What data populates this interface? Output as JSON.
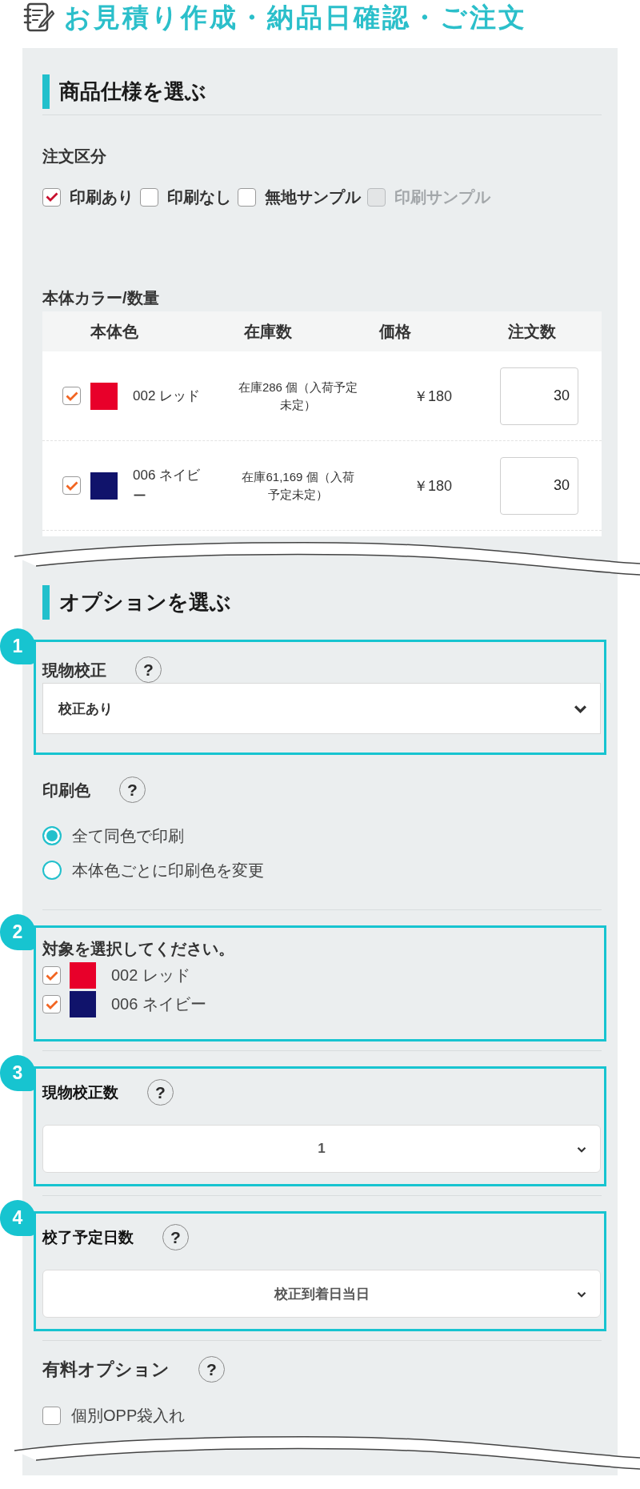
{
  "header": {
    "title": "お見積り作成・納品日確認・ご注文"
  },
  "spec": {
    "heading": "商品仕様を選ぶ",
    "order_type": {
      "label": "注文区分",
      "options": [
        {
          "label": "印刷あり",
          "checked": true,
          "disabled": false
        },
        {
          "label": "印刷なし",
          "checked": false,
          "disabled": false
        },
        {
          "label": "無地サンプル",
          "checked": false,
          "disabled": false
        },
        {
          "label": "印刷サンプル",
          "checked": false,
          "disabled": true
        }
      ]
    },
    "colors": {
      "label": "本体カラー/数量",
      "columns": [
        "本体色",
        "在庫数",
        "価格",
        "注文数"
      ],
      "rows": [
        {
          "checked": true,
          "color": "#e8002a",
          "name": "002 レッド",
          "stock": "在庫286 個（入荷予定未定）",
          "price": "￥180",
          "quantity": "30"
        },
        {
          "checked": true,
          "color": "#10136b",
          "name": "006 ネイビー",
          "stock": "在庫61,169 個（入荷予定未定）",
          "price": "￥180",
          "quantity": "30"
        }
      ]
    }
  },
  "options": {
    "heading": "オプションを選ぶ",
    "fields": [
      {
        "kind": "dropdown",
        "badge": "1",
        "label": "現物校正",
        "help": "?",
        "value": "校正あり"
      },
      {
        "kind": "radio",
        "label": "印刷色",
        "help": "?",
        "options": [
          {
            "label": "全て同色で印刷",
            "selected": true
          },
          {
            "label": "本体色ごとに印刷色を変更",
            "selected": false
          }
        ]
      },
      {
        "kind": "colors",
        "badge": "2",
        "label": "対象を選択してください。",
        "items": [
          {
            "checked": true,
            "color": "#e8002a",
            "name": "002 レッド"
          },
          {
            "checked": true,
            "color": "#10136b",
            "name": "006 ネイビー"
          }
        ]
      },
      {
        "kind": "picker",
        "badge": "3",
        "label": "現物校正数",
        "help": "?",
        "value": "1"
      },
      {
        "kind": "picker",
        "badge": "4",
        "label": "校了予定日数",
        "help": "?",
        "value": "校正到着日当日"
      },
      {
        "kind": "checks",
        "label": "有料オプション",
        "help": "?",
        "options": [
          {
            "label": "個別OPP袋入れ",
            "checked": false
          }
        ]
      }
    ]
  }
}
